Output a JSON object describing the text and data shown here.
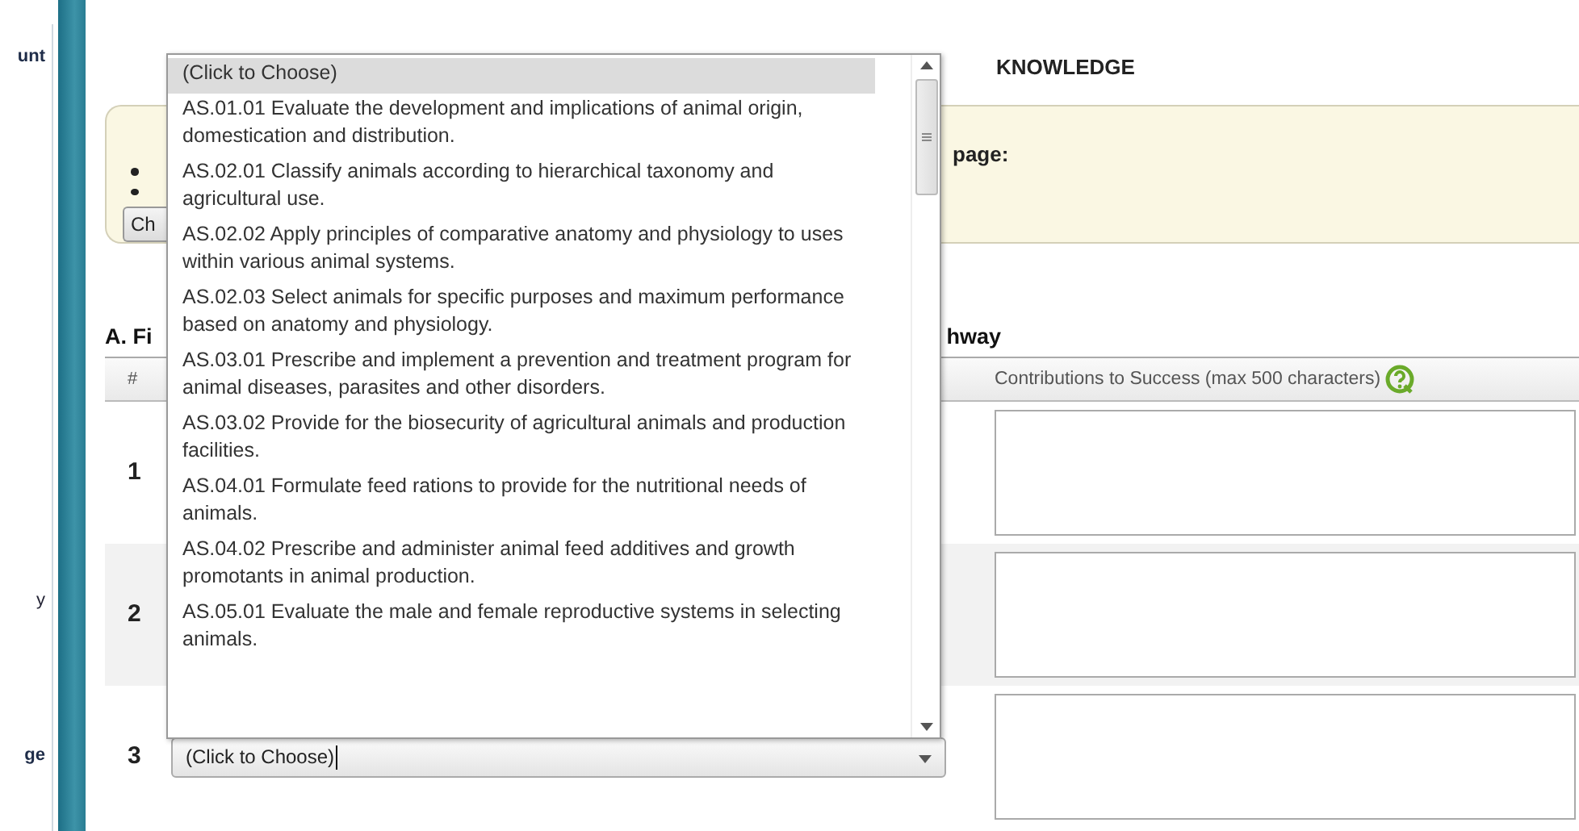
{
  "sidebar": {
    "fragments": [
      {
        "text": "unt",
        "kind": "heading"
      },
      {
        "text": "y",
        "kind": "plain"
      },
      {
        "text": "ge",
        "kind": "heading"
      }
    ]
  },
  "page_heading": "KNOWLEDGE",
  "notice": {
    "text": "page:",
    "button": "Ch"
  },
  "section_heading": {
    "left": "A. Fi",
    "right": "hway"
  },
  "table": {
    "columns": [
      "#",
      "Contributions to Success (max 500 characters)"
    ],
    "rows": [
      {
        "number": "1",
        "shaded": false
      },
      {
        "number": "2",
        "shaded": true
      },
      {
        "number": "3",
        "shaded": false,
        "select_value": "(Click to Choose)"
      }
    ]
  },
  "dropdown": {
    "options": [
      {
        "text": "(Click to Choose)",
        "selected": true
      },
      {
        "text": "AS.01.01 Evaluate the development and implications of animal origin, domestication and distribution.",
        "selected": false
      },
      {
        "text": "AS.02.01 Classify animals according to hierarchical taxonomy and agricultural use.",
        "selected": false
      },
      {
        "text": "AS.02.02 Apply principles of comparative anatomy and physiology to uses within various animal systems.",
        "selected": false
      },
      {
        "text": "AS.02.03 Select animals for specific purposes and maximum performance based on anatomy and physiology.",
        "selected": false
      },
      {
        "text": "AS.03.01 Prescribe and implement a prevention and treatment program for animal diseases, parasites and other disorders.",
        "selected": false
      },
      {
        "text": "AS.03.02 Provide for the biosecurity of agricultural animals and production facilities.",
        "selected": false
      },
      {
        "text": "AS.04.01 Formulate feed rations to provide for the nutritional needs of animals.",
        "selected": false
      },
      {
        "text": "AS.04.02 Prescribe and administer animal feed additives and growth promotants in animal production.",
        "selected": false
      },
      {
        "text": "AS.05.01 Evaluate the male and female reproductive systems in selecting animals.",
        "selected": false
      }
    ]
  }
}
